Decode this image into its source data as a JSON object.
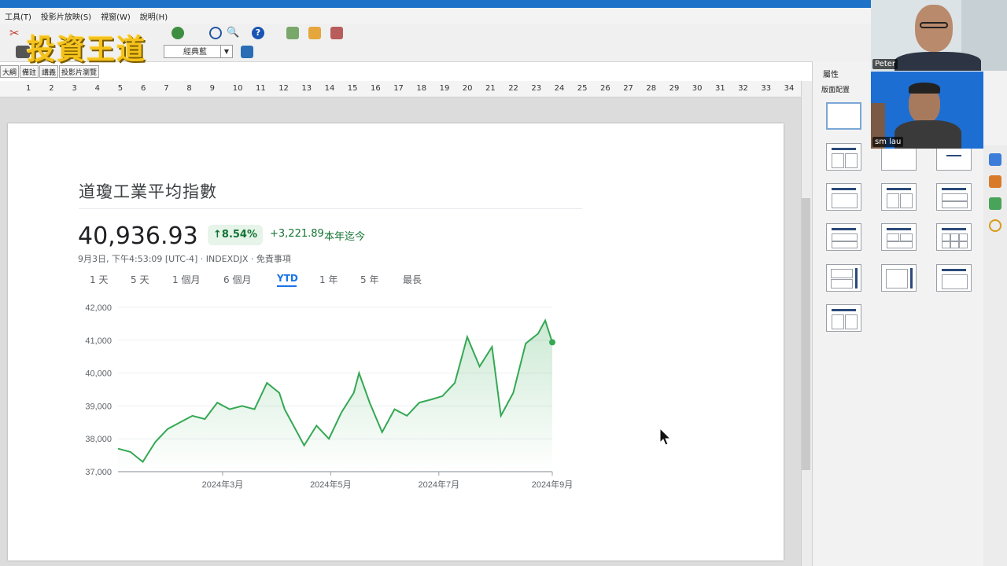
{
  "menu": {
    "items": [
      "工具(T)",
      "投影片放映(S)",
      "視窗(W)",
      "說明(H)"
    ]
  },
  "toolbar": {
    "logo_text": "投資王道",
    "theme_combo_value": "經典藍"
  },
  "view_tabs": [
    "大綱",
    "備註",
    "講義",
    "投影片瀏覽"
  ],
  "ruler": {
    "numbers": [
      "1",
      "2",
      "3",
      "4",
      "5",
      "6",
      "7",
      "8",
      "9",
      "10",
      "11",
      "12",
      "13",
      "14",
      "15",
      "16",
      "17",
      "18",
      "19",
      "20",
      "21",
      "22",
      "23",
      "24",
      "25",
      "26",
      "27",
      "28",
      "29",
      "30",
      "31",
      "32",
      "33",
      "34"
    ]
  },
  "slide": {
    "title": "道瓊工業平均指數",
    "price": "40,936.93",
    "percent_change": "↑8.54%",
    "point_change": "+3,221.89",
    "period_label": "本年迄今",
    "meta": "9月3日, 下午4:53:09 [UTC-4] · INDEXDJX · 免責事項",
    "ranges": [
      "1 天",
      "5 天",
      "1 個月",
      "6 個月",
      "YTD",
      "1 年",
      "5 年",
      "最長"
    ],
    "selected_range": "YTD"
  },
  "chart_data": {
    "type": "line",
    "x": [
      "2024-01-02",
      "2024-01-09",
      "2024-01-16",
      "2024-01-23",
      "2024-01-30",
      "2024-02-06",
      "2024-02-13",
      "2024-02-20",
      "2024-02-27",
      "2024-03-05",
      "2024-03-12",
      "2024-03-19",
      "2024-03-26",
      "2024-04-02",
      "2024-04-05",
      "2024-04-10",
      "2024-04-16",
      "2024-04-23",
      "2024-04-30",
      "2024-05-07",
      "2024-05-14",
      "2024-05-17",
      "2024-05-23",
      "2024-05-30",
      "2024-06-06",
      "2024-06-13",
      "2024-06-20",
      "2024-06-27",
      "2024-07-03",
      "2024-07-10",
      "2024-07-17",
      "2024-07-24",
      "2024-07-31",
      "2024-08-05",
      "2024-08-12",
      "2024-08-19",
      "2024-08-26",
      "2024-08-30",
      "2024-09-03"
    ],
    "values": [
      37700,
      37600,
      37300,
      37900,
      38300,
      38500,
      38700,
      38600,
      39100,
      38900,
      39000,
      38900,
      39700,
      39400,
      38900,
      38400,
      37800,
      38400,
      38000,
      38800,
      39400,
      40000,
      39100,
      38200,
      38900,
      38700,
      39100,
      39200,
      39300,
      39700,
      41100,
      40200,
      40800,
      38700,
      39400,
      40900,
      41200,
      41600,
      40937
    ],
    "x_tick_labels": [
      "2024年3月",
      "2024年5月",
      "2024年7月",
      "2024年9月"
    ],
    "y_tick_labels": [
      "37,000",
      "38,000",
      "39,000",
      "40,000",
      "41,000",
      "42,000"
    ],
    "ylim": [
      37000,
      42000
    ],
    "grid": true,
    "color": "#34a853"
  },
  "panel": {
    "title": "屬性",
    "section": "版面配置"
  },
  "video": {
    "participant1": "Peter",
    "participant2": "sm lau"
  }
}
